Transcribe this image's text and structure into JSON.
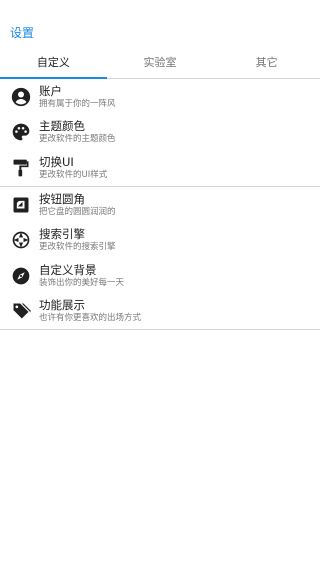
{
  "header": {
    "title": "设置"
  },
  "tabs": [
    {
      "label": "自定义",
      "active": true
    },
    {
      "label": "实验室",
      "active": false
    },
    {
      "label": "其它",
      "active": false
    }
  ],
  "accent_color": "#1e88e5",
  "items": [
    {
      "label": "账户",
      "desc": "拥有属于你的一阵风",
      "icon": "account-icon"
    },
    {
      "label": "主题颜色",
      "desc": "更改软件的主题颜色",
      "icon": "palette-icon"
    },
    {
      "label": "切换UI",
      "desc": "更改软件的UI样式",
      "icon": "paint-roller-icon"
    },
    {
      "label": "按钮圆角",
      "desc": "把它盘的圆圆润润的",
      "icon": "rounded-corner-icon"
    },
    {
      "label": "搜索引擎",
      "desc": "更改软件的搜索引擎",
      "icon": "search-engine-icon"
    },
    {
      "label": "自定义背景",
      "desc": "装饰出你的美好每一天",
      "icon": "compass-icon"
    },
    {
      "label": "功能展示",
      "desc": "也许有你更喜欢的出场方式",
      "icon": "tags-icon"
    }
  ]
}
